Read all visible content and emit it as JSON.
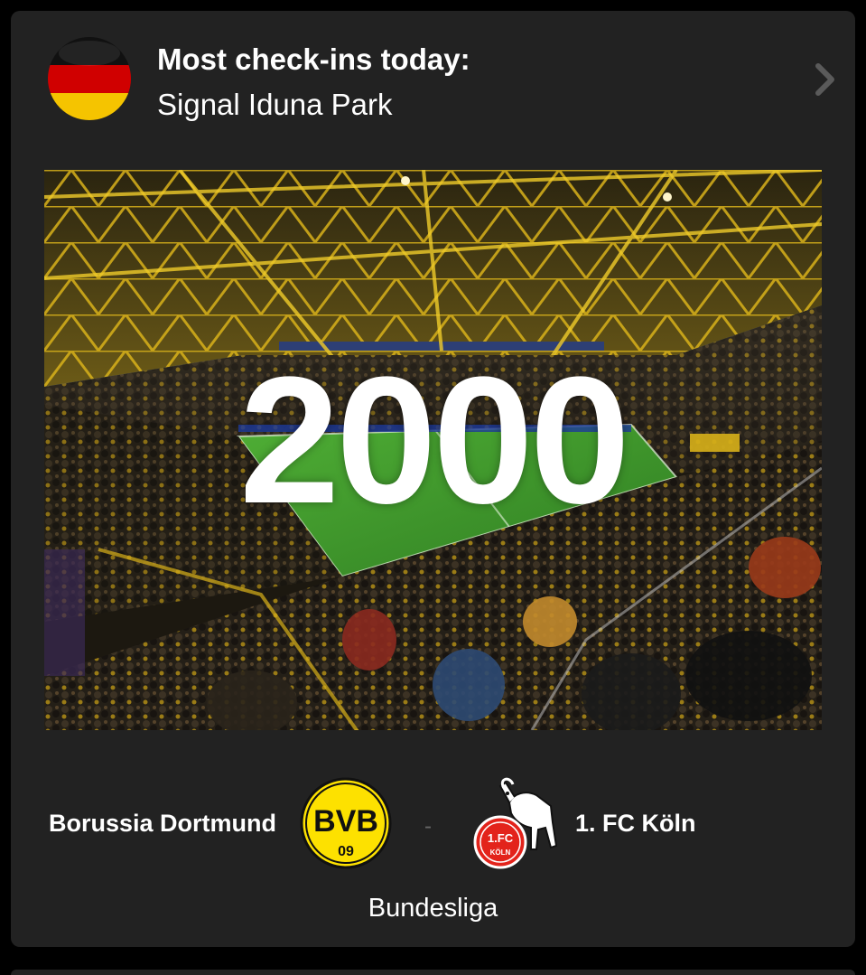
{
  "header": {
    "title": "Most check-ins today:",
    "venue": "Signal Iduna Park",
    "flag_icon": "germany-flag-icon",
    "chevron_icon": "chevron-right-icon"
  },
  "stat": {
    "count": "2000"
  },
  "match": {
    "home_team": "Borussia Dortmund",
    "home_logo_text_top": "BVB",
    "home_logo_text_bottom": "09",
    "separator": "-",
    "away_team": "1. FC Köln",
    "away_logo_text_top": "1.FC",
    "away_logo_text_bottom": "KÖLN",
    "competition": "Bundesliga"
  },
  "colors": {
    "card_bg": "#222222",
    "page_bg": "#000000",
    "text": "#ffffff",
    "bvb_yellow": "#FDE100",
    "koeln_red": "#E3231B",
    "pitch_green": "#3f9a2d"
  }
}
